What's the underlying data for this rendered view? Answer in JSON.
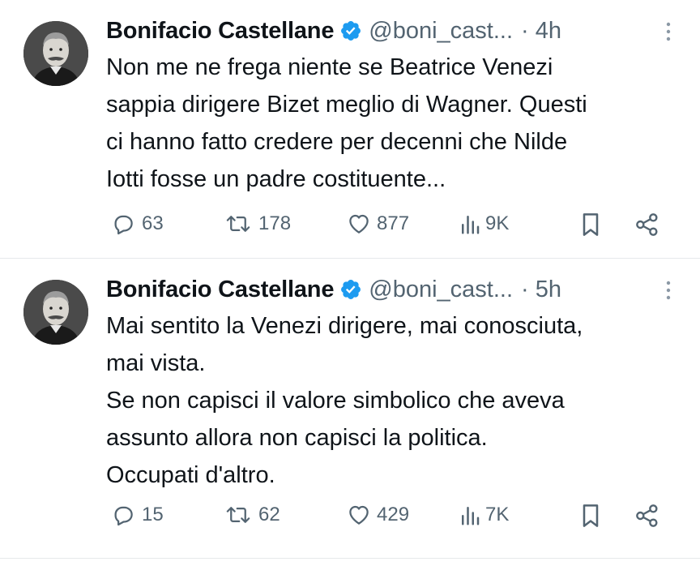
{
  "tweets": [
    {
      "author": {
        "name": "Bonifacio Castellane",
        "handle": "@boni_cast...",
        "verified": true,
        "avatar": "avatar-photo-icon"
      },
      "time": "· 4h",
      "text": "Non me ne frega niente se Beatrice Venezi\nsappia dirigere Bizet meglio di Wagner. Questi\nci hanno fatto credere per decenni che Nilde\nIotti fosse un padre costituente...",
      "stats": {
        "replies": "63",
        "reposts": "178",
        "likes": "877",
        "views": "9K"
      }
    },
    {
      "author": {
        "name": "Bonifacio Castellane",
        "handle": "@boni_cast...",
        "verified": true,
        "avatar": "avatar-photo-icon"
      },
      "time": "· 5h",
      "text": "Mai sentito la Venezi dirigere, mai conosciuta,\nmai vista.\nSe non capisci il valore simbolico che aveva\nassunto allora non capisci la politica.\nOccupati d'altro.",
      "stats": {
        "replies": "15",
        "reposts": "62",
        "likes": "429",
        "views": "7K"
      }
    }
  ],
  "colors": {
    "text": "#0f1419",
    "secondary": "#536471",
    "verified": "#1d9bf0",
    "divider": "#e6e9eb"
  }
}
